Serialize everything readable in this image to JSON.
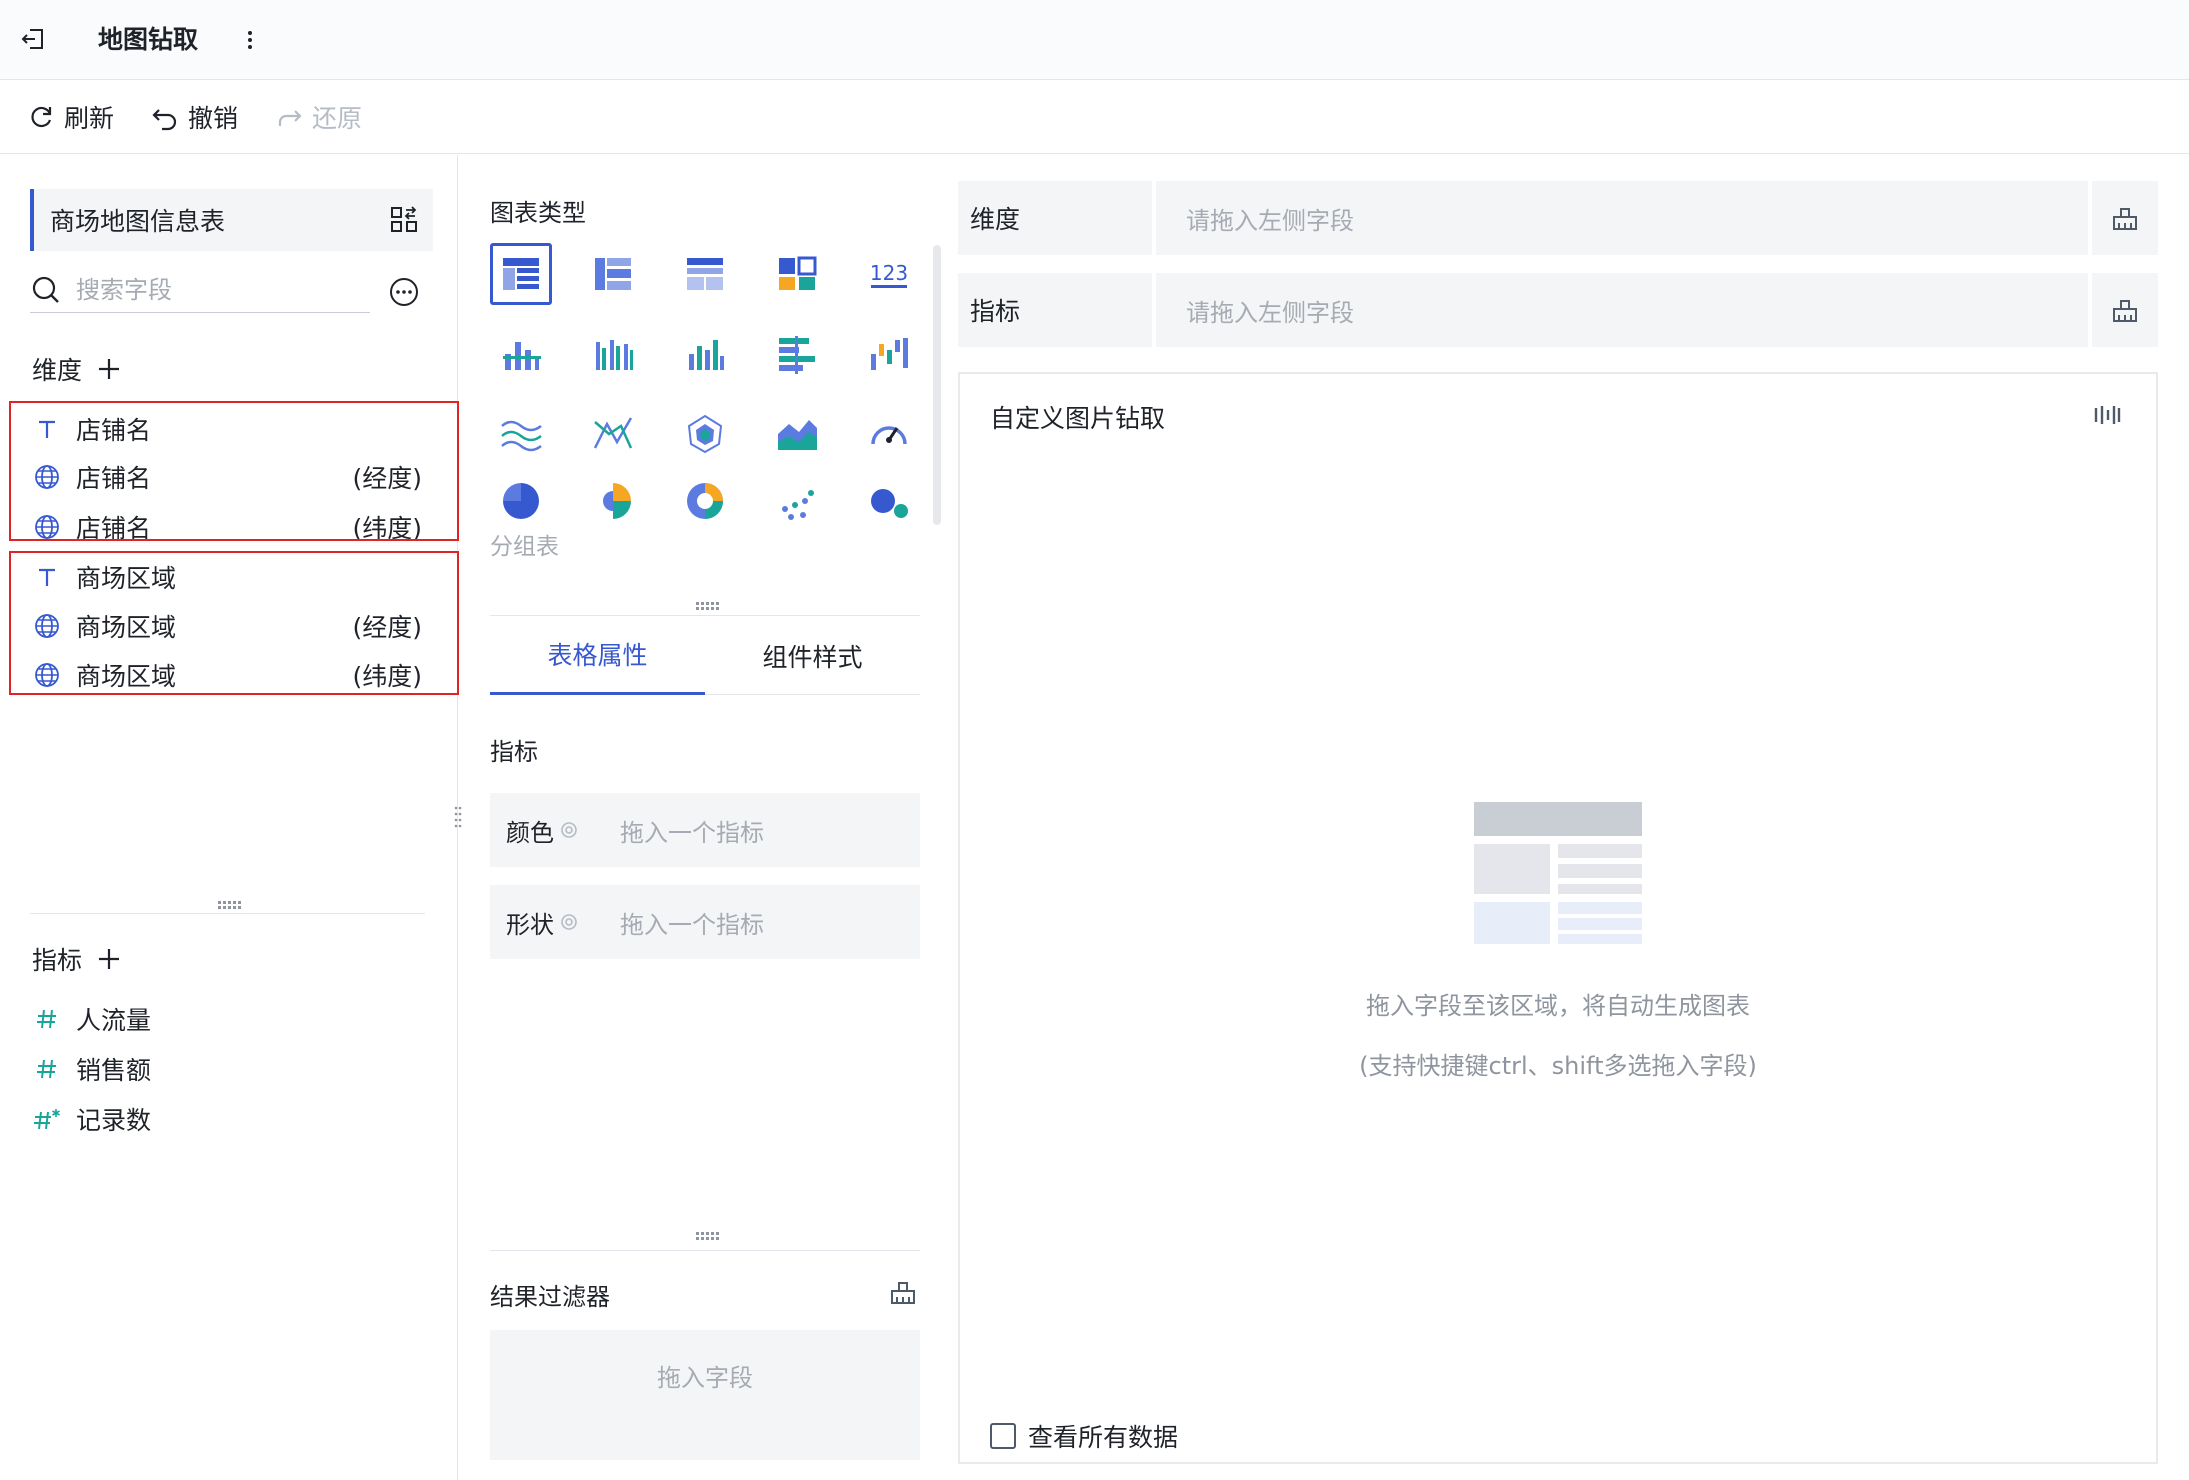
{
  "header": {
    "title": "地图钻取"
  },
  "toolbar": {
    "refresh": "刷新",
    "undo": "撤销",
    "redo": "还原"
  },
  "left": {
    "dataset_name": "商场地图信息表",
    "search_placeholder": "搜索字段",
    "dimensions_label": "维度",
    "dimension_fields": [
      {
        "name": "店铺名",
        "suffix": "",
        "icon": "text-icon"
      },
      {
        "name": "店铺名",
        "suffix": "(经度)",
        "icon": "globe-icon"
      },
      {
        "name": "店铺名",
        "suffix": "(纬度)",
        "icon": "globe-icon"
      },
      {
        "name": "商场区域",
        "suffix": "",
        "icon": "text-icon"
      },
      {
        "name": "商场区域",
        "suffix": "(经度)",
        "icon": "globe-icon"
      },
      {
        "name": "商场区域",
        "suffix": "(纬度)",
        "icon": "globe-icon"
      }
    ],
    "measures_label": "指标",
    "measure_fields": [
      {
        "name": "人流量",
        "icon": "hash-icon"
      },
      {
        "name": "销售额",
        "icon": "hash-icon"
      },
      {
        "name": "记录数",
        "icon": "hash-star-icon"
      }
    ]
  },
  "middle": {
    "chart_types_label": "图表类型",
    "selected_chart_caption": "分组表",
    "tabs": [
      {
        "label": "表格属性"
      },
      {
        "label": "组件样式"
      }
    ],
    "measure_label": "指标",
    "color_label": "颜色",
    "shape_label": "形状",
    "drop_measure_placeholder": "拖入一个指标",
    "filter_label": "结果过滤器",
    "filter_placeholder": "拖入字段"
  },
  "right": {
    "dimension_shelf_label": "维度",
    "measure_shelf_label": "指标",
    "shelf_placeholder": "请拖入左侧字段",
    "canvas_title": "自定义图片钻取",
    "hint_main": "拖入字段至该区域，将自动生成图表",
    "hint_sub": "(支持快捷键ctrl、shift多选拖入字段)",
    "view_all_label": "查看所有数据"
  },
  "colors": {
    "accent": "#3759d0",
    "highlight_box": "#e02424",
    "measure_icon": "#1aa59a",
    "panel_bg": "#f4f5f7"
  }
}
